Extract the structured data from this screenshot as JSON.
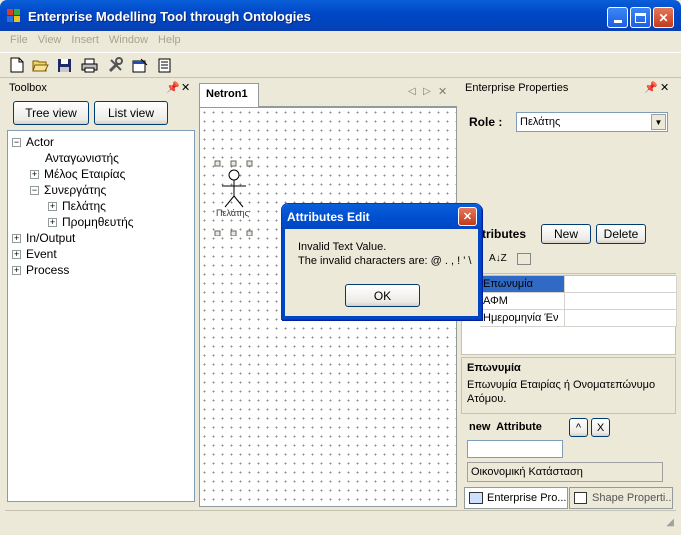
{
  "window": {
    "title": "Enterprise Modelling Tool through Ontologies"
  },
  "menu": [
    "File",
    "View",
    "Insert",
    "Window",
    "Help"
  ],
  "toolbox": {
    "title": "Toolbox",
    "tree_view_label": "Tree view",
    "list_view_label": "List view",
    "tree": [
      {
        "label": "Actor",
        "expander": "−",
        "level": 0
      },
      {
        "label": "Ανταγωνιστής",
        "expander": "",
        "level": 1
      },
      {
        "label": "Μέλος Εταιρίας",
        "expander": "+",
        "level": 1
      },
      {
        "label": "Συνεργάτης",
        "expander": "−",
        "level": 1
      },
      {
        "label": "Πελάτης",
        "expander": "+",
        "level": 2
      },
      {
        "label": "Προμηθευτής",
        "expander": "+",
        "level": 2
      },
      {
        "label": "In/Output",
        "expander": "+",
        "level": 0
      },
      {
        "label": "Event",
        "expander": "+",
        "level": 0
      },
      {
        "label": "Process",
        "expander": "+",
        "level": 0
      }
    ]
  },
  "editor": {
    "tab_label": "Netron1",
    "actor_label": "Πελάτης"
  },
  "properties": {
    "title": "Enterprise Properties",
    "role_label": "Role :",
    "role_value": "Πελάτης",
    "attributes_label": "ttributes",
    "new_label": "New",
    "delete_label": "Delete",
    "grid_rows": [
      "Επωνυμία",
      "ΑΦΜ",
      "Ημερομηνία Έν"
    ],
    "desc_title": "Επωνυμία",
    "desc_text": "Επωνυμία Εταιρίας ή Ονοματεπώνυμο Ατόμου.",
    "new_attribute_label": "new  Attribute",
    "up_label": "^",
    "remove_label": "X",
    "new_attribute_value": "",
    "financial_status": "Οικονομική Κατάσταση",
    "tab_enterprise": "Enterprise Pro...",
    "tab_shape": "Shape Properti..."
  },
  "dialog": {
    "title": "Attributes Edit",
    "line1": "Invalid Text Value.",
    "line2": "The invalid characters are: @ . , ! ' \\",
    "ok_label": "OK"
  }
}
